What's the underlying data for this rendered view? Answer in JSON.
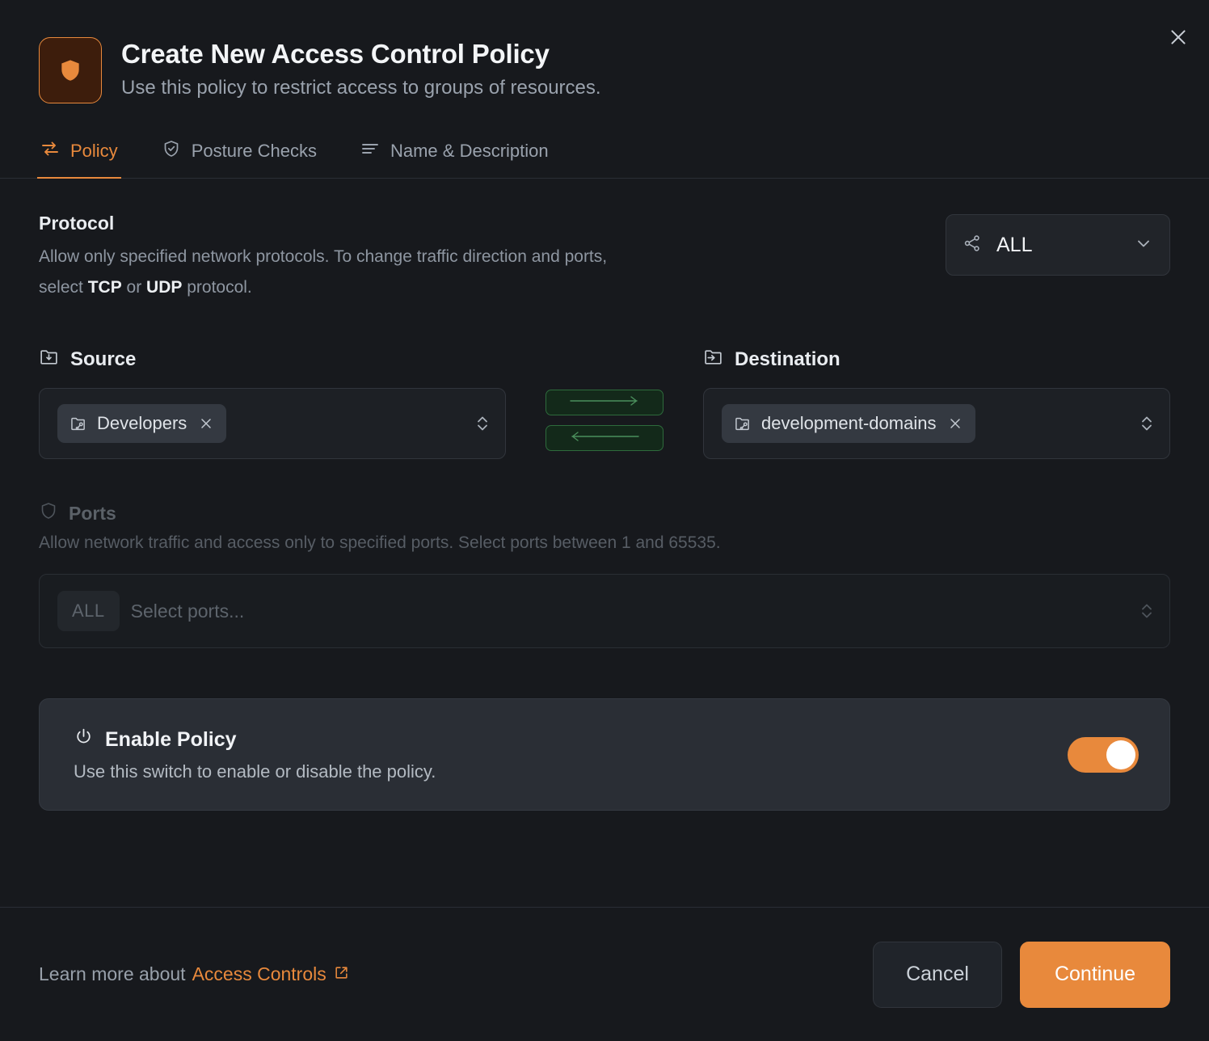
{
  "dialog": {
    "title": "Create New Access Control Policy",
    "subtitle": "Use this policy to restrict access to groups of resources.",
    "badge_icon": "shield-icon",
    "close_icon": "close-icon"
  },
  "tabs": [
    {
      "label": "Policy",
      "icon": "transfer-icon",
      "active": true
    },
    {
      "label": "Posture Checks",
      "icon": "shield-check-icon",
      "active": false
    },
    {
      "label": "Name & Description",
      "icon": "list-icon",
      "active": false
    }
  ],
  "protocol": {
    "title": "Protocol",
    "desc_1": "Allow only specified network protocols. To change traffic direction and ports, select ",
    "desc_tcp": "TCP",
    "desc_or": " or ",
    "desc_udp": "UDP",
    "desc_2": " protocol.",
    "select_value": "ALL",
    "select_icon": "share-network-icon",
    "chevron_icon": "chevron-down-icon"
  },
  "source": {
    "label": "Source",
    "icon": "folder-in-icon",
    "chips": [
      {
        "label": "Developers",
        "icon": "folder-group-icon",
        "remove_icon": "close-icon"
      }
    ],
    "stepper_icon": "chevron-updown-icon"
  },
  "direction": {
    "forward_icon": "arrow-right-icon",
    "backward_icon": "arrow-left-icon",
    "forward_active": true,
    "backward_active": true,
    "active_color": "#4b8f5c"
  },
  "destination": {
    "label": "Destination",
    "icon": "folder-out-icon",
    "chips": [
      {
        "label": "development-domains",
        "icon": "folder-group-icon",
        "remove_icon": "close-icon"
      }
    ],
    "stepper_icon": "chevron-updown-icon"
  },
  "ports": {
    "title": "Ports",
    "icon": "shield-outline-icon",
    "desc": "Allow network traffic and access only to specified ports. Select ports between 1 and 65535.",
    "badge": "ALL",
    "placeholder": "Select ports...",
    "stepper_icon": "chevron-updown-icon",
    "disabled": true
  },
  "enable_policy": {
    "title": "Enable Policy",
    "icon": "power-icon",
    "subtitle": "Use this switch to enable or disable the policy.",
    "toggle_on": true,
    "toggle_color": "#e8893c"
  },
  "footer": {
    "learn_prefix": "Learn more about",
    "learn_link": "Access Controls",
    "learn_link_icon": "external-link-icon",
    "cancel_label": "Cancel",
    "continue_label": "Continue"
  },
  "colors": {
    "accent": "#e8893c",
    "background": "#17191d",
    "card": "#2a2e35",
    "border": "#31353c",
    "text_primary": "#f1f3f6",
    "text_muted": "#9aa2ad",
    "green": "#4b8f5c"
  }
}
